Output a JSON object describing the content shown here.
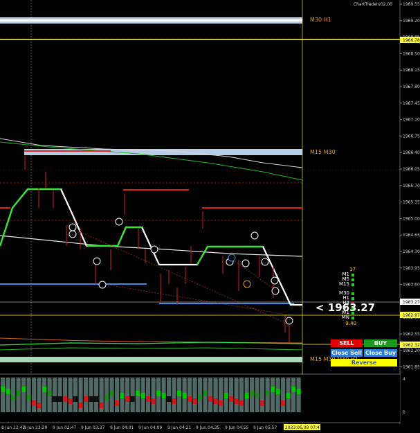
{
  "app": {
    "title": "ChartTraderv02.00"
  },
  "price_axis": {
    "ticks": [
      "1969.55",
      "1969.20",
      "1968.85",
      "1968.50",
      "1968.15",
      "1967.80",
      "1967.45",
      "1967.10",
      "1966.75",
      "1966.40",
      "1966.05",
      "1965.70",
      "1965.35",
      "1965.00",
      "1964.65",
      "1964.30",
      "1963.95",
      "1963.60",
      "1963.25",
      "1962.90",
      "1962.55",
      "1962.20",
      "1961.85"
    ],
    "highlight_top": "1966.78",
    "highlight_current": "1963.27",
    "highlight_bid": "1962.97",
    "highlight_low": "1962.32"
  },
  "time_axis": {
    "ticks": [
      "8 Jun 22:42",
      "8 Jun 23:29",
      "9 Jun 02:47",
      "9 Jun 03:37",
      "9 Jun 04:01",
      "9 Jun 04:09",
      "9 Jun 04:21",
      "9 Jun 04:35",
      "9 Jun 04:55",
      "9 Jun 05:57"
    ],
    "current_label": "2023.06.09 07:47"
  },
  "zones": {
    "top": "M30 H1",
    "middle": "M15 M30",
    "bottom": "M15 M30 M30 H1"
  },
  "indicator_axis": {
    "top": "4",
    "bottom": "0"
  },
  "timeframes": {
    "top_count": "17",
    "items": [
      "M1",
      "M5",
      "M15",
      "M30",
      "H1",
      "H4",
      "D1",
      "W1",
      "MN"
    ],
    "timer": "9:40"
  },
  "current_price_display": "< 1963.27",
  "buttons": {
    "sell": "SELL",
    "buy": "BUY",
    "close_sell": "Close Sell",
    "close_buy": "Close Buy",
    "reverse": "Reverse"
  },
  "colors": {
    "support_zone": "#b8cce4",
    "accent_green": "#00c800",
    "sell_red": "#e00000",
    "buy_green": "#1a9c1a",
    "close_blue": "#2d7ed8",
    "reverse_yellow": "#ffff00"
  }
}
